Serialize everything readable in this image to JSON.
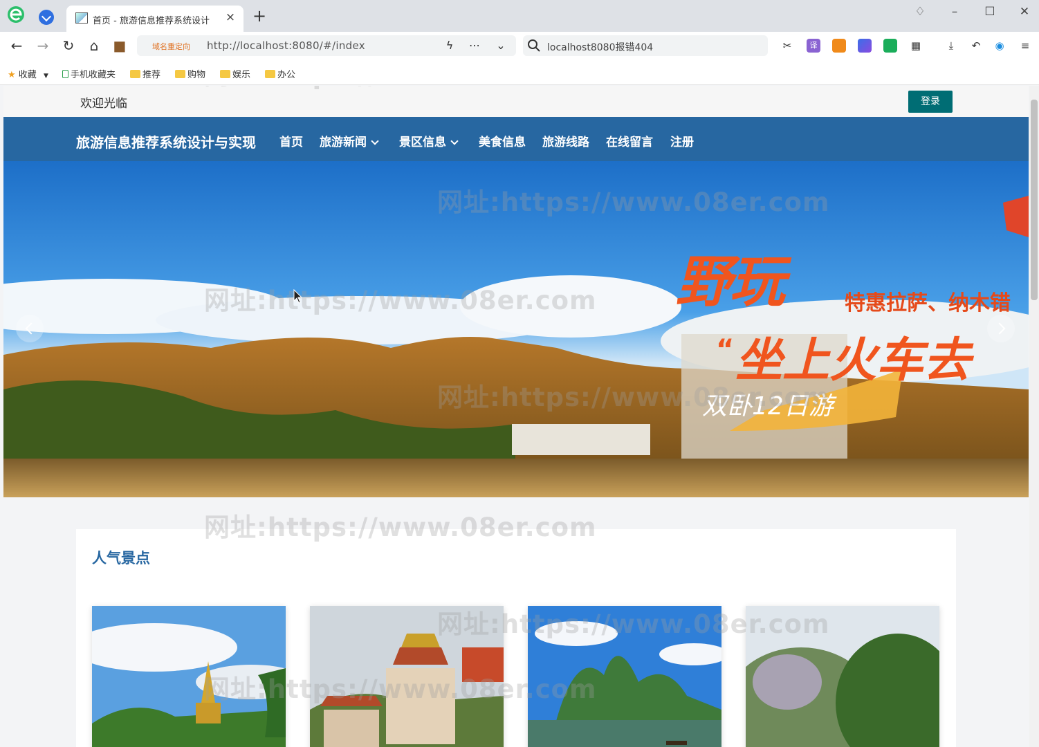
{
  "browser": {
    "tab_title": "首页 - 旅游信息推荐系统设计",
    "redirect_tag": "域名重定向",
    "url": "http://localhost:8080/#/index",
    "search_text": "localhost8080报错404",
    "icons": [
      "back-icon",
      "forward-icon",
      "reload-icon",
      "home-icon",
      "briefcase-icon",
      "bolt-icon",
      "more-icon",
      "dropdown-icon",
      "search-icon",
      "cut-icon",
      "translate-icon",
      "game-icon",
      "screenshot-icon",
      "wechat-icon",
      "apps-icon",
      "download-icon",
      "undo-icon",
      "sync-icon",
      "menu-icon"
    ]
  },
  "bookmarks": [
    "收藏",
    "手机收藏夹",
    "推荐",
    "购物",
    "娱乐",
    "办公"
  ],
  "site": {
    "welcome": "欢迎光临",
    "login": "登录",
    "brand": "旅游信息推荐系统设计与实现",
    "nav": [
      {
        "label": "首页",
        "dropdown": false
      },
      {
        "label": "旅游新闻",
        "dropdown": true
      },
      {
        "label": "景区信息",
        "dropdown": true
      },
      {
        "label": "美食信息",
        "dropdown": false
      },
      {
        "label": "旅游线路",
        "dropdown": false
      },
      {
        "label": "在线留言",
        "dropdown": false
      },
      {
        "label": "注册",
        "dropdown": false
      }
    ],
    "banner": {
      "line1": "野玩",
      "line2": "特惠拉萨、纳木错",
      "line3": "坐上火车去",
      "line4": "双卧12日游"
    },
    "section_title": "人气景点"
  },
  "watermark": "网址:https://www.08er.com",
  "colors": {
    "navbar": "#2767a1",
    "login_button": "#006d74",
    "slogan": "#f0551e"
  }
}
